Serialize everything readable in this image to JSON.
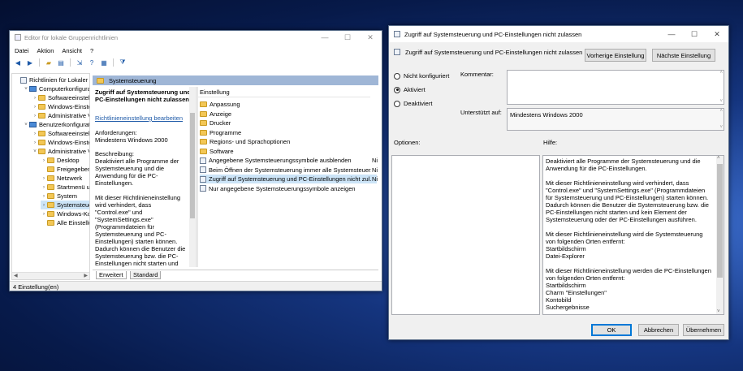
{
  "gpe": {
    "title": "Editor für lokale Gruppenrichtlinien",
    "menu": [
      "Datei",
      "Aktion",
      "Ansicht",
      "?"
    ],
    "tree": [
      {
        "label": "Richtlinien für Lokaler Co",
        "type": "pol",
        "indent": 0,
        "arrow": ""
      },
      {
        "label": "Computerkonfigurat",
        "type": "pc",
        "indent": 1,
        "arrow": "˅"
      },
      {
        "label": "Softwareeinstellu",
        "type": "folder",
        "indent": 2,
        "arrow": "›"
      },
      {
        "label": "Windows-Einstell",
        "type": "folder",
        "indent": 2,
        "arrow": "›"
      },
      {
        "label": "Administrative Vo",
        "type": "folder",
        "indent": 2,
        "arrow": "›"
      },
      {
        "label": "Benutzerkonfiguratic",
        "type": "pc",
        "indent": 1,
        "arrow": "˅"
      },
      {
        "label": "Softwareeinstellu",
        "type": "folder",
        "indent": 2,
        "arrow": "›"
      },
      {
        "label": "Windows-Einstell",
        "type": "folder",
        "indent": 2,
        "arrow": "›"
      },
      {
        "label": "Administrative Vo",
        "type": "folder",
        "indent": 2,
        "arrow": "˅"
      },
      {
        "label": "Desktop",
        "type": "folder",
        "indent": 3,
        "arrow": "›"
      },
      {
        "label": "Freigegebene",
        "type": "folder",
        "indent": 3,
        "arrow": ""
      },
      {
        "label": "Netzwerk",
        "type": "folder",
        "indent": 3,
        "arrow": "›"
      },
      {
        "label": "Startmenü un",
        "type": "folder",
        "indent": 3,
        "arrow": "›"
      },
      {
        "label": "System",
        "type": "folder",
        "indent": 3,
        "arrow": "›"
      },
      {
        "label": "Systemsteuer",
        "type": "folder",
        "indent": 3,
        "arrow": "›",
        "selected": true
      },
      {
        "label": "Windows-Kor",
        "type": "folder",
        "indent": 3,
        "arrow": "›"
      },
      {
        "label": "Alle Einstellur",
        "type": "folder",
        "indent": 3,
        "arrow": ""
      }
    ],
    "header": "Systemsteuerung",
    "desc": {
      "heading": "Zugriff auf Systemsteuerung und PC-Einstellungen nicht zulassen",
      "link": "Richtlinieneinstellung bearbeiten",
      "req_label": "Anforderungen:",
      "req_value": "Mindestens Windows 2000",
      "desc_label": "Beschreibung:",
      "desc_text": "Deaktiviert alle Programme der Systemsteuerung und die Anwendung für die PC-Einstellungen.",
      "desc_text2": "Mit dieser Richtlinieneinstellung wird verhindert, dass \"Control.exe\" und \"SystemSettings.exe\" (Programmdateien für Systemsteuerung und PC-Einstellungen) starten können. Dadurch können die Benutzer die Systemsteuerung bzw. die PC-Einstellungen nicht starten und kein Element der Systemsteuerung"
    },
    "list_header": "Einstellung",
    "list_items": [
      {
        "label": "Anpassung",
        "type": "folder",
        "state": ""
      },
      {
        "label": "Anzeige",
        "type": "folder",
        "state": ""
      },
      {
        "label": "Drucker",
        "type": "folder",
        "state": ""
      },
      {
        "label": "Programme",
        "type": "folder",
        "state": ""
      },
      {
        "label": "Regions- und Sprachoptionen",
        "type": "folder",
        "state": ""
      },
      {
        "label": "Software",
        "type": "folder",
        "state": ""
      },
      {
        "label": "Angegebene Systemsteuerungssymbole ausblenden",
        "type": "pol",
        "state": "Ni"
      },
      {
        "label": "Beim Öffnen der Systemsteuerung immer alle Systemsteuer...",
        "type": "pol",
        "state": "Ni"
      },
      {
        "label": "Zugriff auf Systemsteuerung und PC-Einstellungen nicht zul...",
        "type": "pol",
        "state": "Ni",
        "selected": true
      },
      {
        "label": "Nur angegebene Systemsteuerungssymbole anzeigen",
        "type": "pol",
        "state": ""
      }
    ],
    "tabs": [
      "Erweitert",
      "Standard"
    ],
    "status": "4 Einstellung(en)"
  },
  "dlg": {
    "title": "Zugriff auf Systemsteuerung und PC-Einstellungen nicht zulassen",
    "policy_name": "Zugriff auf Systemsteuerung und PC-Einstellungen nicht zulassen",
    "prev_btn": "Vorherige Einstellung",
    "next_btn": "Nächste Einstellung",
    "radio_not_configured": "Nicht konfiguriert",
    "radio_enabled": "Aktiviert",
    "radio_disabled": "Deaktiviert",
    "comment_label": "Kommentar:",
    "supported_label": "Unterstützt auf:",
    "supported_value": "Mindestens Windows 2000",
    "options_label": "Optionen:",
    "help_label": "Hilfe:",
    "help_p1": "Deaktiviert alle Programme der Systemsteuerung und die Anwendung für die PC-Einstellungen.",
    "help_p2": "Mit dieser Richtlinieneinstellung wird verhindert, dass \"Control.exe\" und \"SystemSettings.exe\" (Programmdateien für Systemsteuerung und PC-Einstellungen) starten können. Dadurch können die Benutzer die Systemsteuerung bzw. die PC-Einstellungen nicht starten und kein Element der Systemsteuerung oder der PC-Einstellungen ausführen.",
    "help_p3": "Mit dieser Richtlinieneinstellung wird die Systemsteuerung von folgenden Orten entfernt:",
    "help_p3_list": [
      "Startbildschirm",
      "Datei-Explorer"
    ],
    "help_p4": "Mit dieser Richtlinieneinstellung werden die PC-Einstellungen von folgenden Orten entfernt:",
    "help_p4_list": [
      "Startbildschirm",
      "Charm \"Einstellungen\"",
      "Kontobild",
      "Suchergebnisse"
    ],
    "ok": "OK",
    "cancel": "Abbrechen",
    "apply": "Übernehmen"
  }
}
